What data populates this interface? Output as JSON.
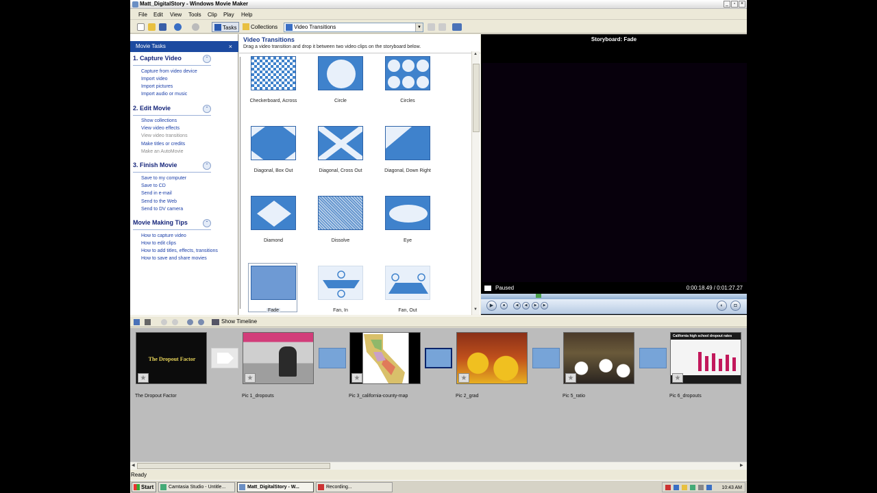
{
  "window": {
    "title": "Matt_DigitalStory - Windows Movie Maker",
    "min": "_",
    "max": "▫",
    "close": "×"
  },
  "menu": [
    "File",
    "Edit",
    "View",
    "Tools",
    "Clip",
    "Play",
    "Help"
  ],
  "toolbar": {
    "tasks": "Tasks",
    "collections": "Collections",
    "collection_select": "Video Transitions"
  },
  "task_pane": {
    "header": "Movie Tasks",
    "close": "×",
    "sections": [
      {
        "title": "1. Capture Video",
        "toggle": "⌃",
        "links": [
          {
            "label": "Capture from video device",
            "enabled": true
          },
          {
            "label": "Import video",
            "enabled": true
          },
          {
            "label": "Import pictures",
            "enabled": true
          },
          {
            "label": "Import audio or music",
            "enabled": true
          }
        ]
      },
      {
        "title": "2. Edit Movie",
        "toggle": "⌃",
        "links": [
          {
            "label": "Show collections",
            "enabled": true
          },
          {
            "label": "View video effects",
            "enabled": true
          },
          {
            "label": "View video transitions",
            "enabled": false
          },
          {
            "label": "Make titles or credits",
            "enabled": true
          },
          {
            "label": "Make an AutoMovie",
            "enabled": false
          }
        ]
      },
      {
        "title": "3. Finish Movie",
        "toggle": "⌃",
        "links": [
          {
            "label": "Save to my computer",
            "enabled": true
          },
          {
            "label": "Save to CD",
            "enabled": true
          },
          {
            "label": "Send in e-mail",
            "enabled": true
          },
          {
            "label": "Send to the Web",
            "enabled": true
          },
          {
            "label": "Send to DV camera",
            "enabled": true
          }
        ]
      },
      {
        "title": "Movie Making Tips",
        "toggle": "⌃",
        "links": [
          {
            "label": "How to capture video",
            "enabled": true
          },
          {
            "label": "How to edit clips",
            "enabled": true
          },
          {
            "label": "How to add titles, effects, transitions",
            "enabled": true
          },
          {
            "label": "How to save and share movies",
            "enabled": true
          }
        ]
      }
    ]
  },
  "collection": {
    "title": "Video Transitions",
    "subtitle": "Drag a video transition and drop it between two video clips on the storyboard below.",
    "items": [
      {
        "label": "Checkerboard, Across",
        "icon": "checkerboard-icon"
      },
      {
        "label": "Circle",
        "icon": "circle-icon"
      },
      {
        "label": "Circles",
        "icon": "circles-icon"
      },
      {
        "label": "Diagonal, Box Out",
        "icon": "diagonal-box-out-icon"
      },
      {
        "label": "Diagonal, Cross Out",
        "icon": "diagonal-cross-out-icon"
      },
      {
        "label": "Diagonal, Down Right",
        "icon": "diagonal-down-right-icon"
      },
      {
        "label": "Diamond",
        "icon": "diamond-icon"
      },
      {
        "label": "Dissolve",
        "icon": "dissolve-icon"
      },
      {
        "label": "Eye",
        "icon": "eye-icon"
      },
      {
        "label": "Fade",
        "icon": "fade-icon",
        "selected": true
      },
      {
        "label": "Fan, In",
        "icon": "fan-in-icon"
      },
      {
        "label": "Fan, Out",
        "icon": "fan-out-icon"
      }
    ]
  },
  "monitor": {
    "title": "Storyboard: Fade",
    "status": "Paused",
    "time": "0:00:18.49 / 0:01:27.27",
    "position_fraction": 0.21
  },
  "storyboard": {
    "show_timeline": "Show Timeline",
    "clips": [
      {
        "label": "The Dropout Factor",
        "thumb_text": "The Dropout Factor"
      },
      {
        "label": "Pic 1_dropouts"
      },
      {
        "label": "Pic 3_california-county-map"
      },
      {
        "label": "Pic 2_grad"
      },
      {
        "label": "Pic 5_ratio"
      },
      {
        "label": "Pic 6_dropouts",
        "thumb_text": "California high school dropout rates"
      }
    ]
  },
  "status_bar": "Ready",
  "taskbar": {
    "start": "Start",
    "tasks": [
      "Camtasia Studio - Untitle...",
      "Matt_DigitalStory - W...",
      "Recording..."
    ],
    "clock": "10:43 AM"
  },
  "colors": {
    "accent": "#1c4aa0",
    "transition_blue": "#3f82cc",
    "link": "#1a3ea8"
  }
}
